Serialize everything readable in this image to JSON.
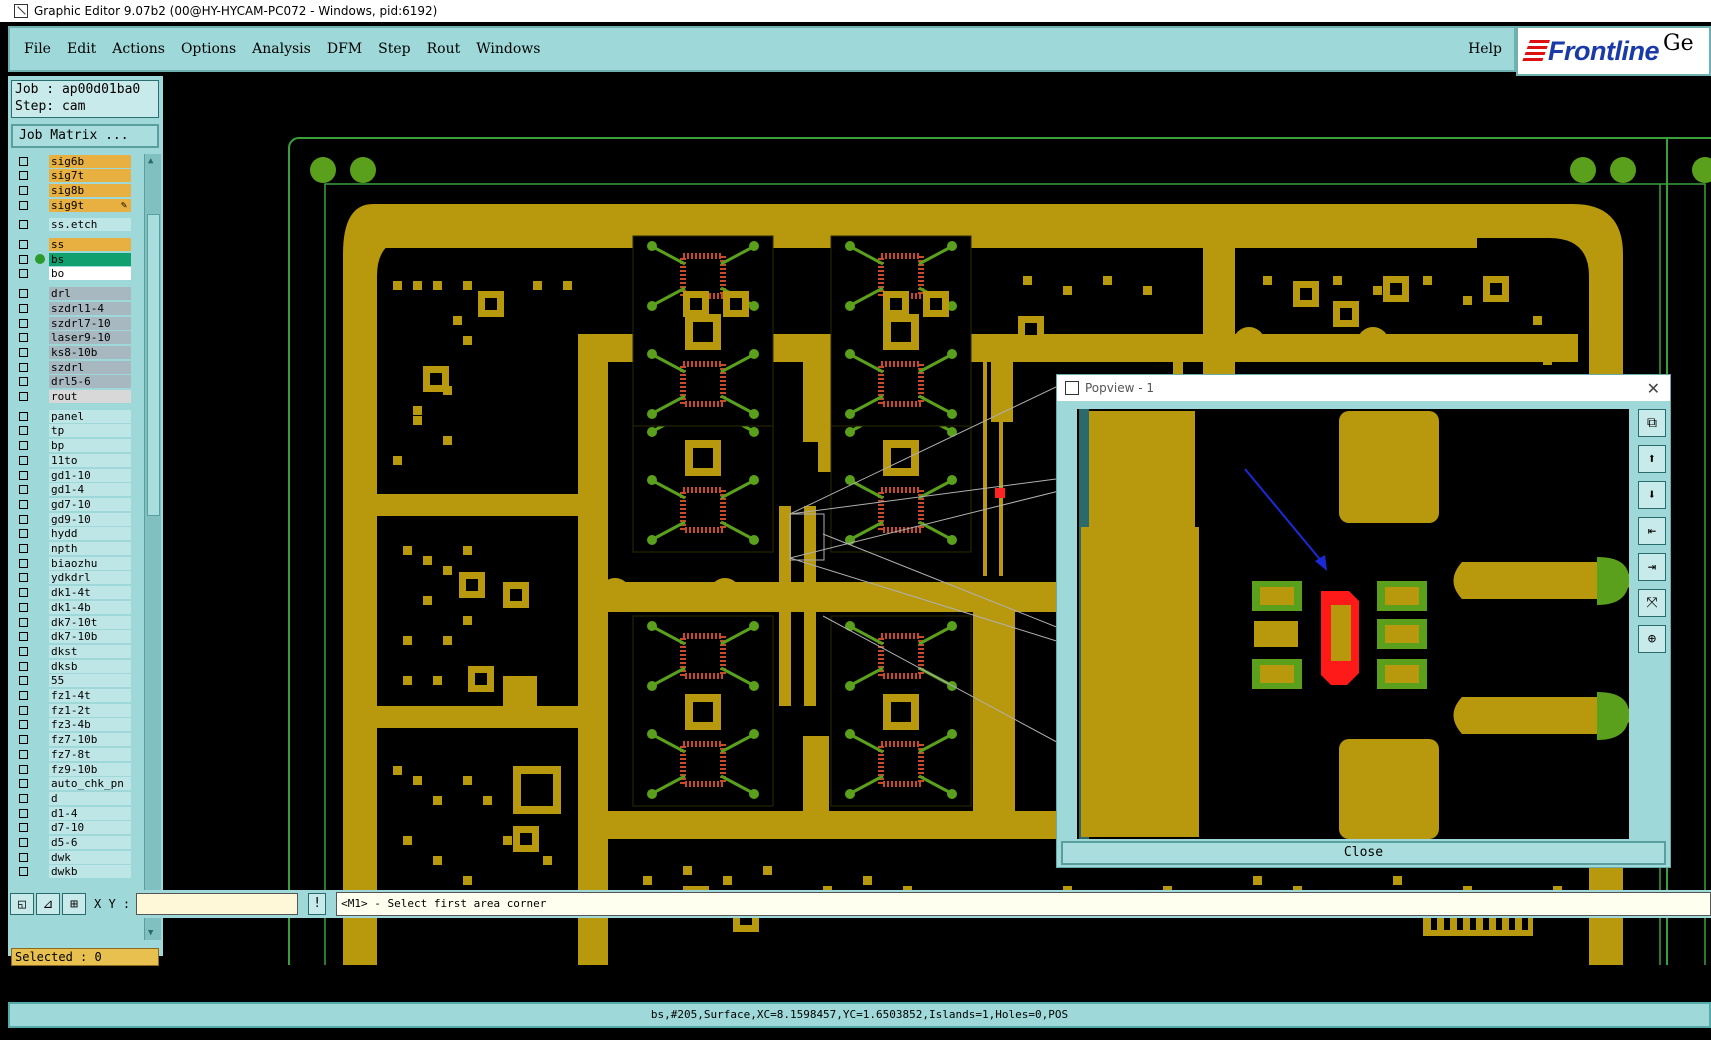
{
  "window": {
    "title": "Graphic Editor 9.07b2 (00@HY-HYCAM-PC072 - Windows, pid:6192)"
  },
  "menu": {
    "items": [
      "File",
      "Edit",
      "Actions",
      "Options",
      "Analysis",
      "DFM",
      "Step",
      "Rout",
      "Windows"
    ],
    "help": "Help"
  },
  "logo": {
    "brand": "Frontline",
    "suffix": "Ge"
  },
  "job": {
    "job_line": "Job : ap00d01ba0",
    "step_line": "Step: cam",
    "matrix_button": "Job Matrix ..."
  },
  "layers": [
    {
      "name": "sig6b",
      "color": "#e8b040"
    },
    {
      "name": "sig7t",
      "color": "#e8b040"
    },
    {
      "name": "sig8b",
      "color": "#e8b040"
    },
    {
      "name": "sig9t",
      "color": "#e8b040",
      "mark": "✎"
    },
    {
      "name": "ss.etch",
      "color": "#bfe6e6",
      "gap": true
    },
    {
      "name": "ss",
      "color": "#e8b040",
      "gap": true
    },
    {
      "name": "bs",
      "color": "#10a070",
      "active": true
    },
    {
      "name": "bo",
      "color": "#ffffff"
    },
    {
      "name": "drl",
      "color": "#a8b8c0",
      "gap": true
    },
    {
      "name": "szdrl1-4",
      "color": "#a8b8c0"
    },
    {
      "name": "szdrl7-10",
      "color": "#a8b8c0"
    },
    {
      "name": "laser9-10",
      "color": "#a8b8c0"
    },
    {
      "name": "ks8-10b",
      "color": "#a8b8c0"
    },
    {
      "name": "szdrl",
      "color": "#a8b8c0"
    },
    {
      "name": "drl5-6",
      "color": "#a8b8c0"
    },
    {
      "name": "rout",
      "color": "#d8d8d8"
    },
    {
      "name": "panel",
      "color": "#bfe6e6",
      "gap": true
    },
    {
      "name": "tp",
      "color": "#bfe6e6"
    },
    {
      "name": "bp",
      "color": "#bfe6e6"
    },
    {
      "name": "11to",
      "color": "#bfe6e6"
    },
    {
      "name": "gd1-10",
      "color": "#bfe6e6"
    },
    {
      "name": "gd1-4",
      "color": "#bfe6e6"
    },
    {
      "name": "gd7-10",
      "color": "#bfe6e6"
    },
    {
      "name": "gd9-10",
      "color": "#bfe6e6"
    },
    {
      "name": "hydd",
      "color": "#bfe6e6"
    },
    {
      "name": "npth",
      "color": "#bfe6e6"
    },
    {
      "name": "biaozhu",
      "color": "#bfe6e6"
    },
    {
      "name": "ydkdrl",
      "color": "#bfe6e6"
    },
    {
      "name": "dk1-4t",
      "color": "#bfe6e6"
    },
    {
      "name": "dk1-4b",
      "color": "#bfe6e6"
    },
    {
      "name": "dk7-10t",
      "color": "#bfe6e6"
    },
    {
      "name": "dk7-10b",
      "color": "#bfe6e6"
    },
    {
      "name": "dkst",
      "color": "#bfe6e6"
    },
    {
      "name": "dksb",
      "color": "#bfe6e6"
    },
    {
      "name": "55",
      "color": "#bfe6e6"
    },
    {
      "name": "fz1-4t",
      "color": "#bfe6e6"
    },
    {
      "name": "fz1-2t",
      "color": "#bfe6e6"
    },
    {
      "name": "fz3-4b",
      "color": "#bfe6e6"
    },
    {
      "name": "fz7-10b",
      "color": "#bfe6e6"
    },
    {
      "name": "fz7-8t",
      "color": "#bfe6e6"
    },
    {
      "name": "fz9-10b",
      "color": "#bfe6e6"
    },
    {
      "name": "auto_chk_pn",
      "color": "#bfe6e6"
    },
    {
      "name": "d",
      "color": "#bfe6e6"
    },
    {
      "name": "d1-4",
      "color": "#bfe6e6"
    },
    {
      "name": "d7-10",
      "color": "#bfe6e6"
    },
    {
      "name": "d5-6",
      "color": "#bfe6e6"
    },
    {
      "name": "dwk",
      "color": "#bfe6e6"
    },
    {
      "name": "dwkb",
      "color": "#bfe6e6"
    }
  ],
  "selected": "Selected : 0",
  "coords": {
    "label": "X Y :",
    "value": ""
  },
  "prompt": "<M1> - Select first area corner",
  "status": "bs,#205,Surface,XC=8.1598457,YC=1.6503852,Islands=1,Holes=0,POS",
  "popview": {
    "title": "Popview - 1",
    "close_label": "Close",
    "tools": [
      "zoom-home-icon",
      "zoom-in-icon",
      "zoom-out-icon",
      "pan-left-icon",
      "pan-right-icon",
      "fit-icon",
      "center-icon"
    ]
  },
  "colors": {
    "copper": "#b8980c",
    "pad_green": "#5aa01c",
    "outline": "#3aa03a",
    "highlight": "#ff1a1a",
    "arrow": "#1a2ad8"
  }
}
